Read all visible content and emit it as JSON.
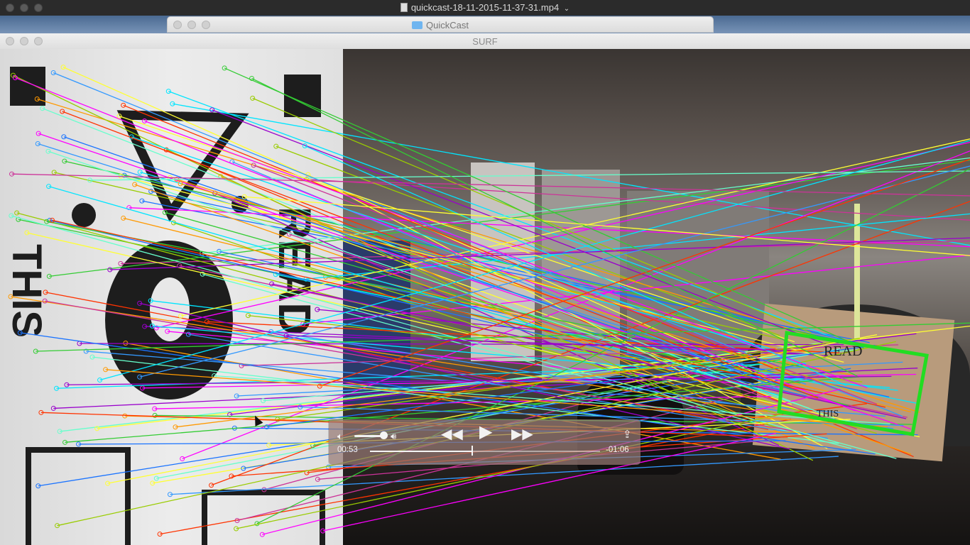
{
  "player": {
    "title": "quickcast-18-11-2015-11-37-31.mp4",
    "title_chevron_icon": "chevron-down-icon"
  },
  "finder": {
    "title": "QuickCast"
  },
  "surf": {
    "title": "SURF"
  },
  "controls": {
    "elapsed": "00:53",
    "remaining": "-01:06",
    "progress": 0.445,
    "volume": 0.85,
    "icons": {
      "mute": "speaker-low-icon",
      "volume_max": "speaker-high-icon",
      "rewind": "rewind-icon",
      "play": "play-icon",
      "fast_forward": "fast-forward-icon",
      "share": "share-icon"
    }
  },
  "template_text": {
    "read": "READ",
    "this": "THIS"
  },
  "colors": {
    "match_lines": [
      "#ff00ff",
      "#00e5ff",
      "#1a73ff",
      "#ffff33",
      "#ff3300",
      "#33cc33",
      "#9900cc",
      "#ff9900",
      "#66ffcc",
      "#cc3399",
      "#3399ff",
      "#99cc00"
    ],
    "detect_box": "#22dd22"
  }
}
